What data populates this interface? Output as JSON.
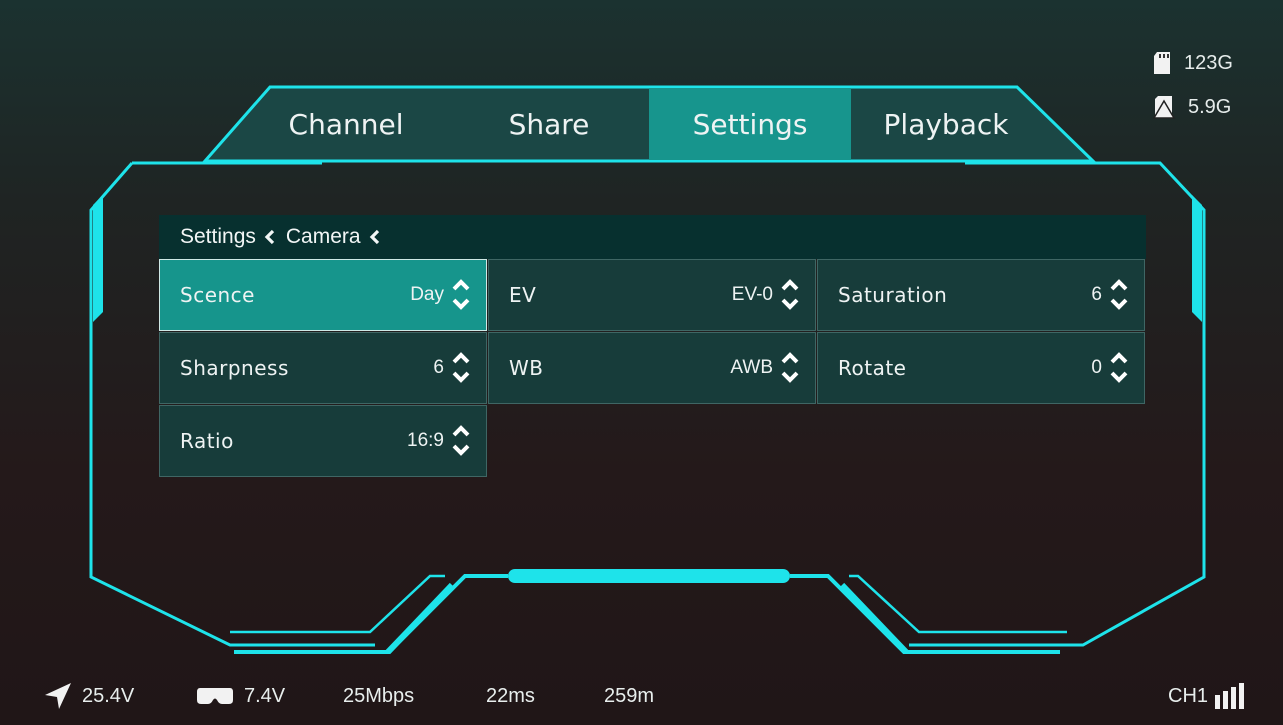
{
  "tabs": [
    {
      "label": "Channel",
      "active": false
    },
    {
      "label": "Share",
      "active": false
    },
    {
      "label": "Settings",
      "active": true
    },
    {
      "label": "Playback",
      "active": false
    }
  ],
  "storage": {
    "sd_card": "123G",
    "recording": "5.9G"
  },
  "breadcrumb": {
    "level1": "Settings",
    "level2": "Camera"
  },
  "settings": [
    {
      "label": "Scence",
      "value": "Day",
      "selected": true
    },
    {
      "label": "EV",
      "value": "EV-0",
      "selected": false
    },
    {
      "label": "Saturation",
      "value": "6",
      "selected": false
    },
    {
      "label": "Sharpness",
      "value": "6",
      "selected": false
    },
    {
      "label": "WB",
      "value": "AWB",
      "selected": false
    },
    {
      "label": "Rotate",
      "value": "0",
      "selected": false
    },
    {
      "label": "Ratio",
      "value": "16:9",
      "selected": false
    }
  ],
  "status": {
    "drone_voltage": "25.4V",
    "goggles_voltage": "7.4V",
    "bitrate": "25Mbps",
    "latency": "22ms",
    "distance": "259m",
    "channel": "CH1"
  },
  "colors": {
    "accent": "#1ee3ea",
    "selected": "#16958c",
    "cell": "#173c3a",
    "header": "#07302f"
  },
  "icons": {
    "drone": "navigation-arrow-icon",
    "goggles": "goggles-icon",
    "sd_card": "sd-card-icon",
    "recording": "sd-card-record-icon",
    "signal": "signal-bars-icon",
    "stepper": "chevron-up-down-icon"
  }
}
